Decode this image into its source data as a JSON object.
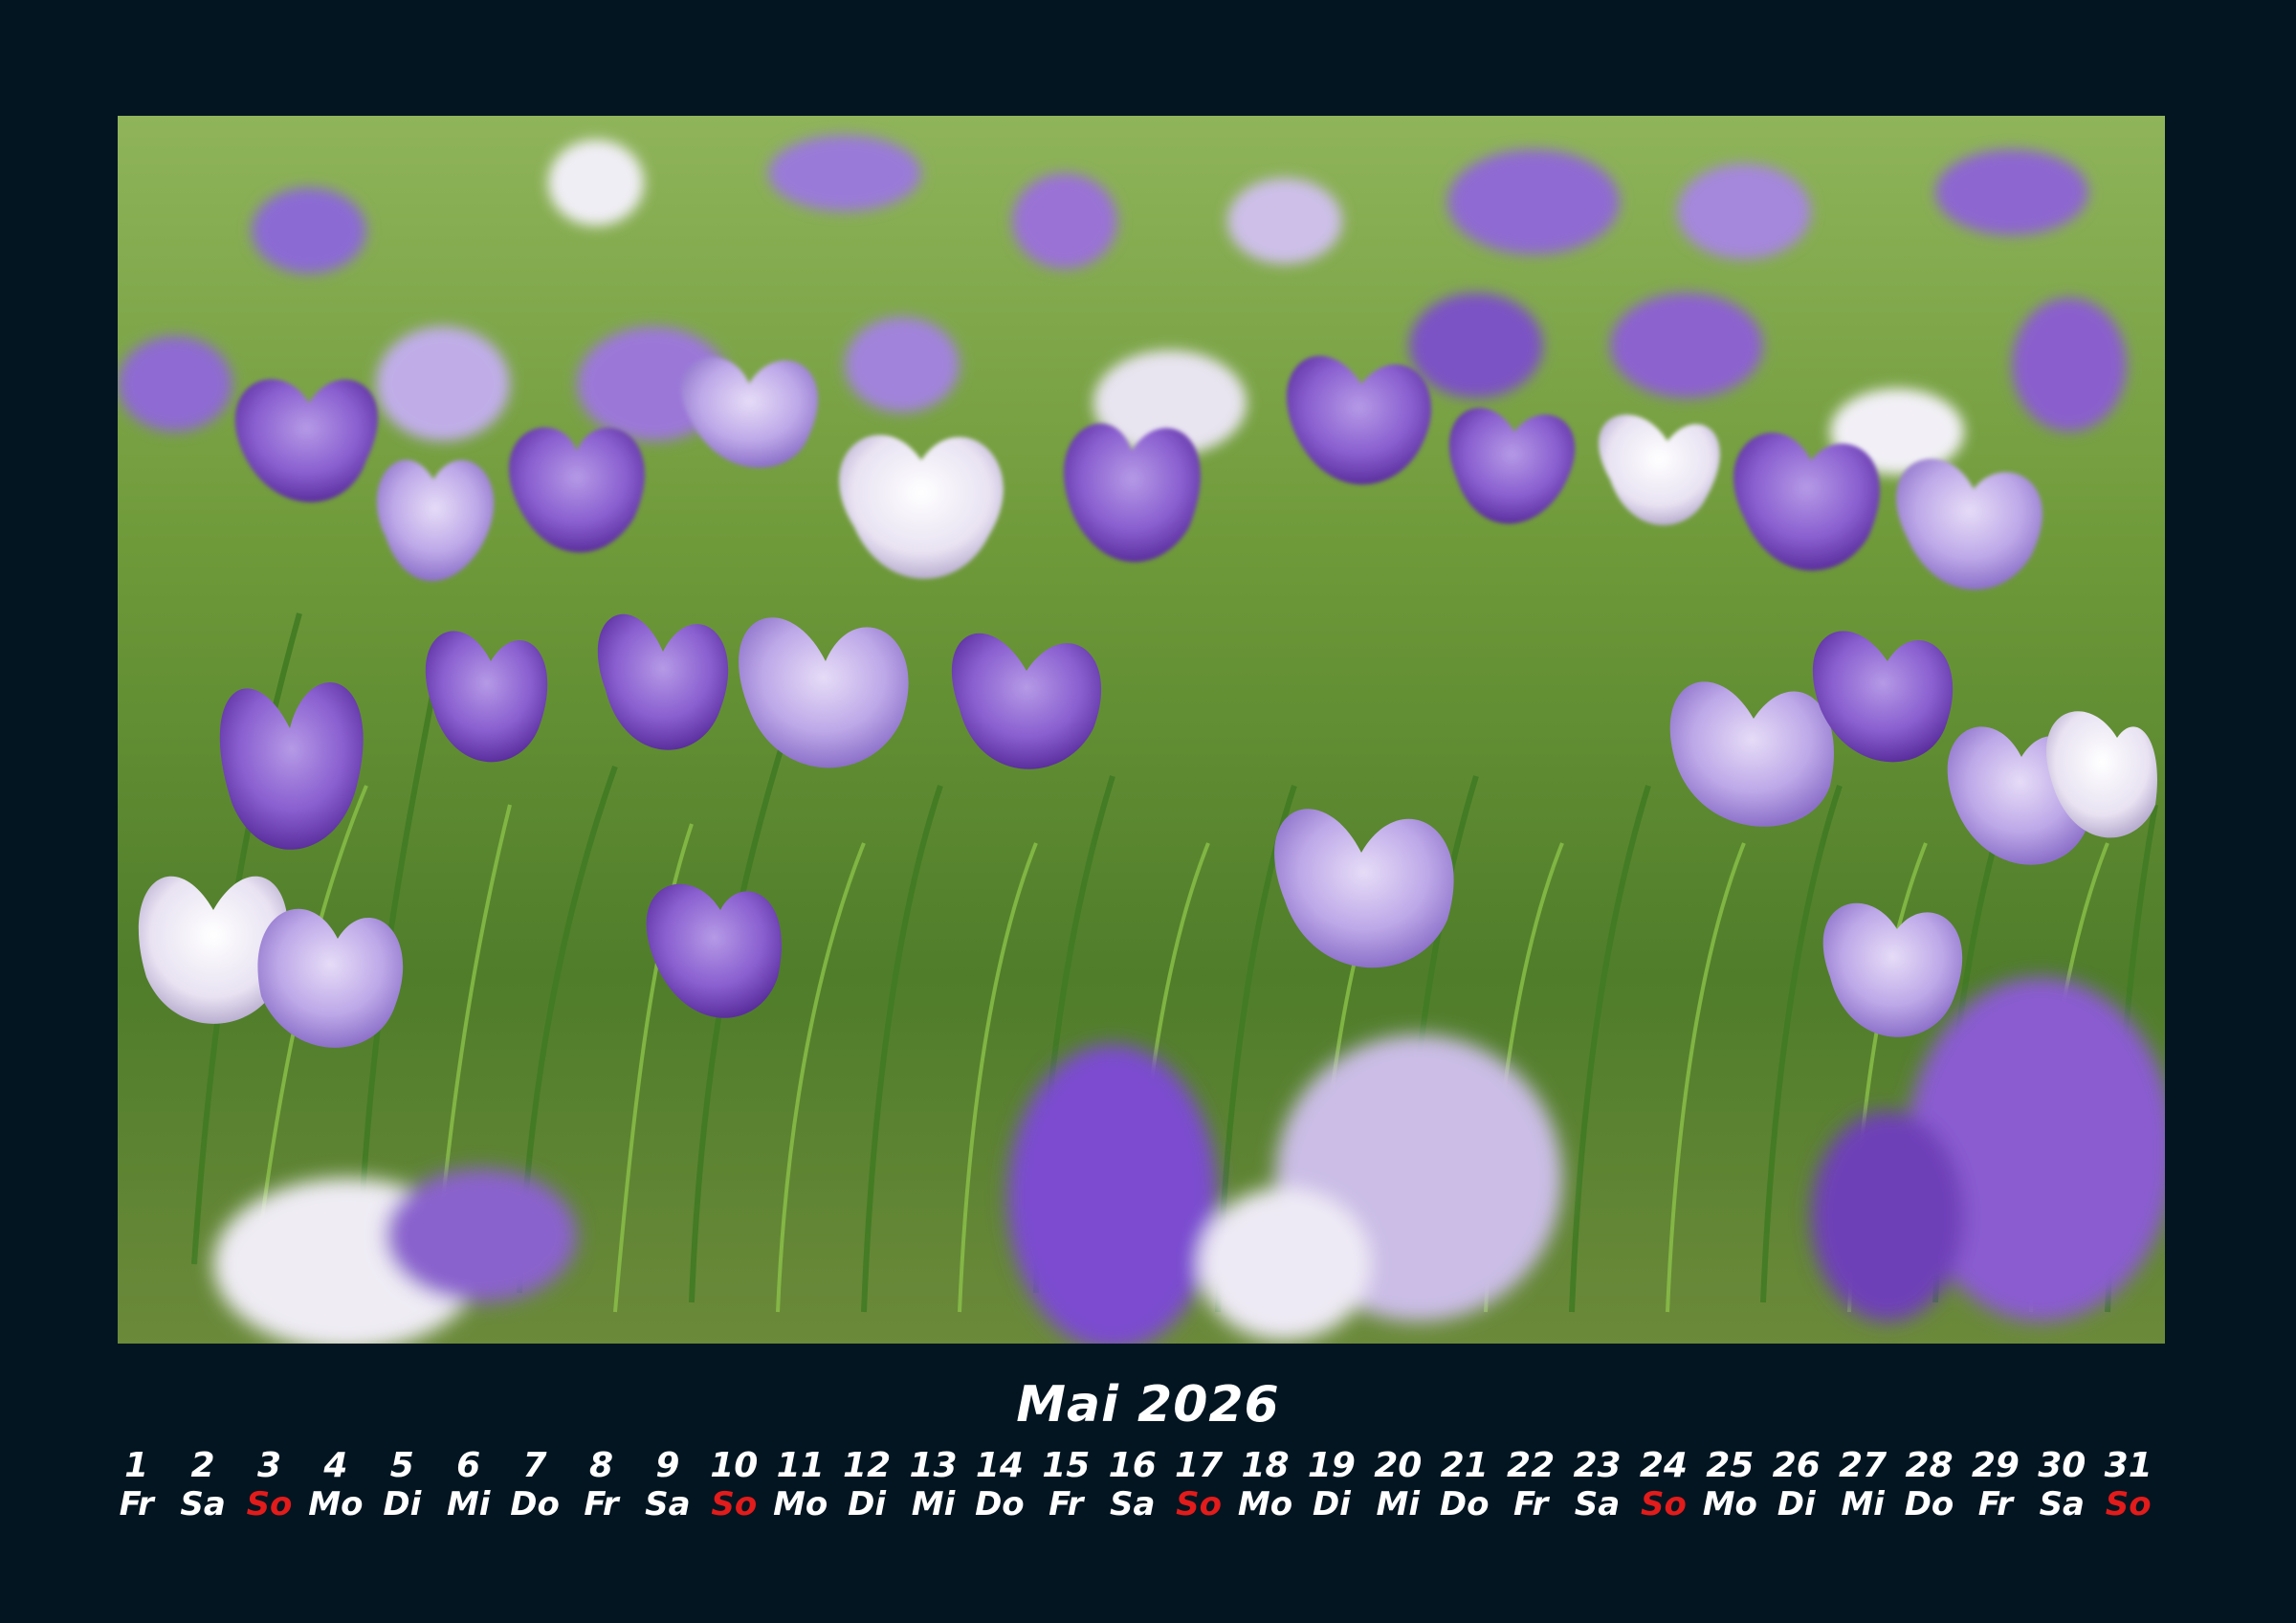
{
  "calendar": {
    "month_title": "Mai 2026",
    "sunday_color": "#e21b1b",
    "days": [
      {
        "num": "1",
        "wd": "Fr"
      },
      {
        "num": "2",
        "wd": "Sa"
      },
      {
        "num": "3",
        "wd": "So"
      },
      {
        "num": "4",
        "wd": "Mo"
      },
      {
        "num": "5",
        "wd": "Di"
      },
      {
        "num": "6",
        "wd": "Mi"
      },
      {
        "num": "7",
        "wd": "Do"
      },
      {
        "num": "8",
        "wd": "Fr"
      },
      {
        "num": "9",
        "wd": "Sa"
      },
      {
        "num": "10",
        "wd": "So"
      },
      {
        "num": "11",
        "wd": "Mo"
      },
      {
        "num": "12",
        "wd": "Di"
      },
      {
        "num": "13",
        "wd": "Mi"
      },
      {
        "num": "14",
        "wd": "Do"
      },
      {
        "num": "15",
        "wd": "Fr"
      },
      {
        "num": "16",
        "wd": "Sa"
      },
      {
        "num": "17",
        "wd": "So"
      },
      {
        "num": "18",
        "wd": "Mo"
      },
      {
        "num": "19",
        "wd": "Di"
      },
      {
        "num": "20",
        "wd": "Mi"
      },
      {
        "num": "21",
        "wd": "Do"
      },
      {
        "num": "22",
        "wd": "Fr"
      },
      {
        "num": "23",
        "wd": "Sa"
      },
      {
        "num": "24",
        "wd": "So"
      },
      {
        "num": "25",
        "wd": "Mo"
      },
      {
        "num": "26",
        "wd": "Di"
      },
      {
        "num": "27",
        "wd": "Mi"
      },
      {
        "num": "28",
        "wd": "Do"
      },
      {
        "num": "29",
        "wd": "Fr"
      },
      {
        "num": "30",
        "wd": "Sa"
      },
      {
        "num": "31",
        "wd": "So"
      }
    ]
  }
}
